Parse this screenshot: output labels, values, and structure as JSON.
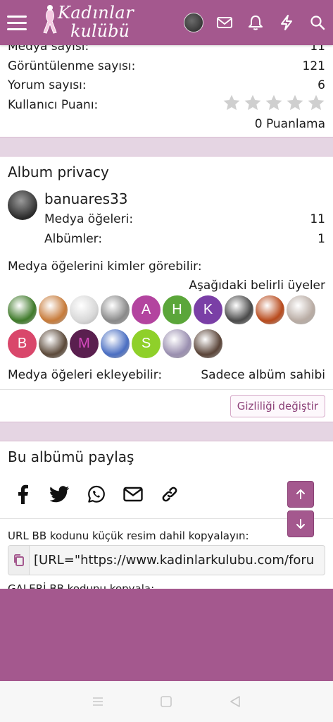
{
  "header": {
    "logo_line1": "Kadınlar",
    "logo_line2": "kulübü",
    "icons": [
      "menu-icon",
      "avatar",
      "mail-icon",
      "bell-icon",
      "bolt-icon",
      "search-icon"
    ]
  },
  "stats": {
    "media_count_label": "Medya sayısı:",
    "media_count_value": "11",
    "views_label": "Görüntülenme sayısı:",
    "views_value": "121",
    "comments_label": "Yorum sayısı:",
    "comments_value": "6",
    "rating_label": "Kullanıcı Puanı:",
    "rating_stars_filled": 0,
    "rating_stars_total": 5,
    "rating_count": "0 Puanlama"
  },
  "privacy": {
    "title": "Album privacy",
    "owner_name": "banuares33",
    "media_items_label": "Medya öğeleri:",
    "media_items_value": "11",
    "albums_label": "Albümler:",
    "albums_value": "1",
    "who_can_view_label": "Medya öğelerini kimler görebilir:",
    "who_can_view_value": "Aşağıdaki belirli üyeler",
    "members_row1": [
      {
        "kind": "photo",
        "color": "#3f7a2a",
        "letter": ""
      },
      {
        "kind": "photo",
        "color": "#c77b3a",
        "letter": ""
      },
      {
        "kind": "photo",
        "color": "#d8d8d8",
        "letter": ""
      },
      {
        "kind": "photo",
        "color": "#8a8a8a",
        "letter": ""
      },
      {
        "kind": "letter",
        "color": "#b3449f",
        "letter": "A"
      },
      {
        "kind": "letter",
        "color": "#5ba63a",
        "letter": "H"
      },
      {
        "kind": "letter",
        "color": "#7a3fa6",
        "letter": "K"
      },
      {
        "kind": "photo",
        "color": "#4a4a4a",
        "letter": ""
      },
      {
        "kind": "photo",
        "color": "#b84a1c",
        "letter": ""
      },
      {
        "kind": "photo",
        "color": "#b9aca4",
        "letter": ""
      }
    ],
    "members_row2": [
      {
        "kind": "letter",
        "color": "#d9476b",
        "letter": "B"
      },
      {
        "kind": "photo",
        "color": "#5c4a3a",
        "letter": ""
      },
      {
        "kind": "letter",
        "color": "#5a1f4f",
        "letter": "M",
        "text_color": "#d84ac0"
      },
      {
        "kind": "photo",
        "color": "#4a6ec2",
        "letter": ""
      },
      {
        "kind": "letter",
        "color": "#8fd02a",
        "letter": "S"
      },
      {
        "kind": "photo",
        "color": "#9a8fb0",
        "letter": ""
      },
      {
        "kind": "photo",
        "color": "#5a4438",
        "letter": ""
      }
    ],
    "who_can_add_label": "Medya öğeleri ekleyebilir:",
    "who_can_add_value": "Sadece albüm sahibi",
    "change_privacy_button": "Gizliliği değiştir"
  },
  "share": {
    "title": "Bu albümü paylaş",
    "icons": [
      "facebook-icon",
      "twitter-icon",
      "whatsapp-icon",
      "email-icon",
      "link-icon"
    ],
    "url_bb_label": "URL BB kodunu küçük resim dahil kopyalayın:",
    "url_bb_value": "[URL=\"https://www.kadinlarkulubu.com/foru",
    "gallery_bb_label": "GALERİ BB kodunu kopyala:"
  },
  "scroll": {
    "up_icon": "arrow-up-icon",
    "down_icon": "arrow-down-icon"
  },
  "colors": {
    "brand": "#a4588e",
    "band": "#e5d5e3",
    "star": "#cfcfcf"
  }
}
